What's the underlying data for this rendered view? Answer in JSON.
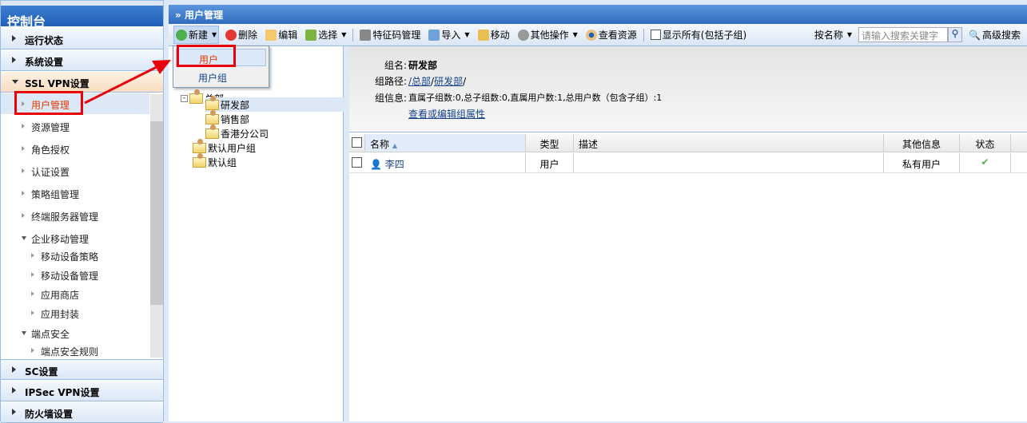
{
  "sidebar": {
    "title": "控制台",
    "sections": [
      {
        "label": "运行状态"
      },
      {
        "label": "系统设置"
      },
      {
        "label": "SSL VPN设置"
      },
      {
        "label": "SC设置"
      },
      {
        "label": "IPSec VPN设置"
      },
      {
        "label": "防火墙设置"
      }
    ],
    "ssl_items": [
      {
        "label": "用户管理"
      },
      {
        "label": "资源管理"
      },
      {
        "label": "角色授权"
      },
      {
        "label": "认证设置"
      },
      {
        "label": "策略组管理"
      },
      {
        "label": "终端服务器管理"
      },
      {
        "label": "企业移动管理"
      },
      {
        "label": "移动设备策略"
      },
      {
        "label": "移动设备管理"
      },
      {
        "label": "应用商店"
      },
      {
        "label": "应用封装"
      },
      {
        "label": "端点安全"
      },
      {
        "label": "端点安全规则"
      }
    ]
  },
  "main": {
    "title": "用户管理",
    "toolbar": {
      "new": "新建",
      "delete": "删除",
      "edit": "编辑",
      "select": "选择",
      "feature_code": "特征码管理",
      "import": "导入",
      "move": "移动",
      "other": "其他操作",
      "view_res": "查看资源",
      "show_all": "显示所有(包括子组)",
      "search_by": "按名称",
      "search_placeholder": "请输入搜索关键字",
      "advanced": "高级搜索"
    },
    "new_menu": [
      {
        "label": "用户"
      },
      {
        "label": "用户组"
      }
    ],
    "tree": [
      {
        "label": "总部"
      },
      {
        "label": "研发部"
      },
      {
        "label": "销售部"
      },
      {
        "label": "香港分公司"
      },
      {
        "label": "默认用户组"
      },
      {
        "label": "默认组"
      }
    ],
    "info": {
      "name_label": "组名:",
      "name": "研发部",
      "path_label": "组路径:",
      "path_parts": [
        "/总部",
        "/",
        "研发部",
        "/"
      ],
      "info_label": "组信息:",
      "info": "直属子组数:0,总子组数:0,直属用户数:1,总用户数（包含子组）:1",
      "edit_link": "查看或编辑组属性"
    },
    "grid": {
      "headers": [
        "名称",
        "类型",
        "描述",
        "其他信息",
        "状态"
      ],
      "rows": [
        {
          "name": "李四",
          "type": "用户",
          "desc": "",
          "other": "私有用户",
          "status": "enabled"
        }
      ]
    }
  },
  "colors": {
    "accent": "#2f6cc0",
    "highlight": "#e8000a",
    "active_text": "#e23a00"
  }
}
